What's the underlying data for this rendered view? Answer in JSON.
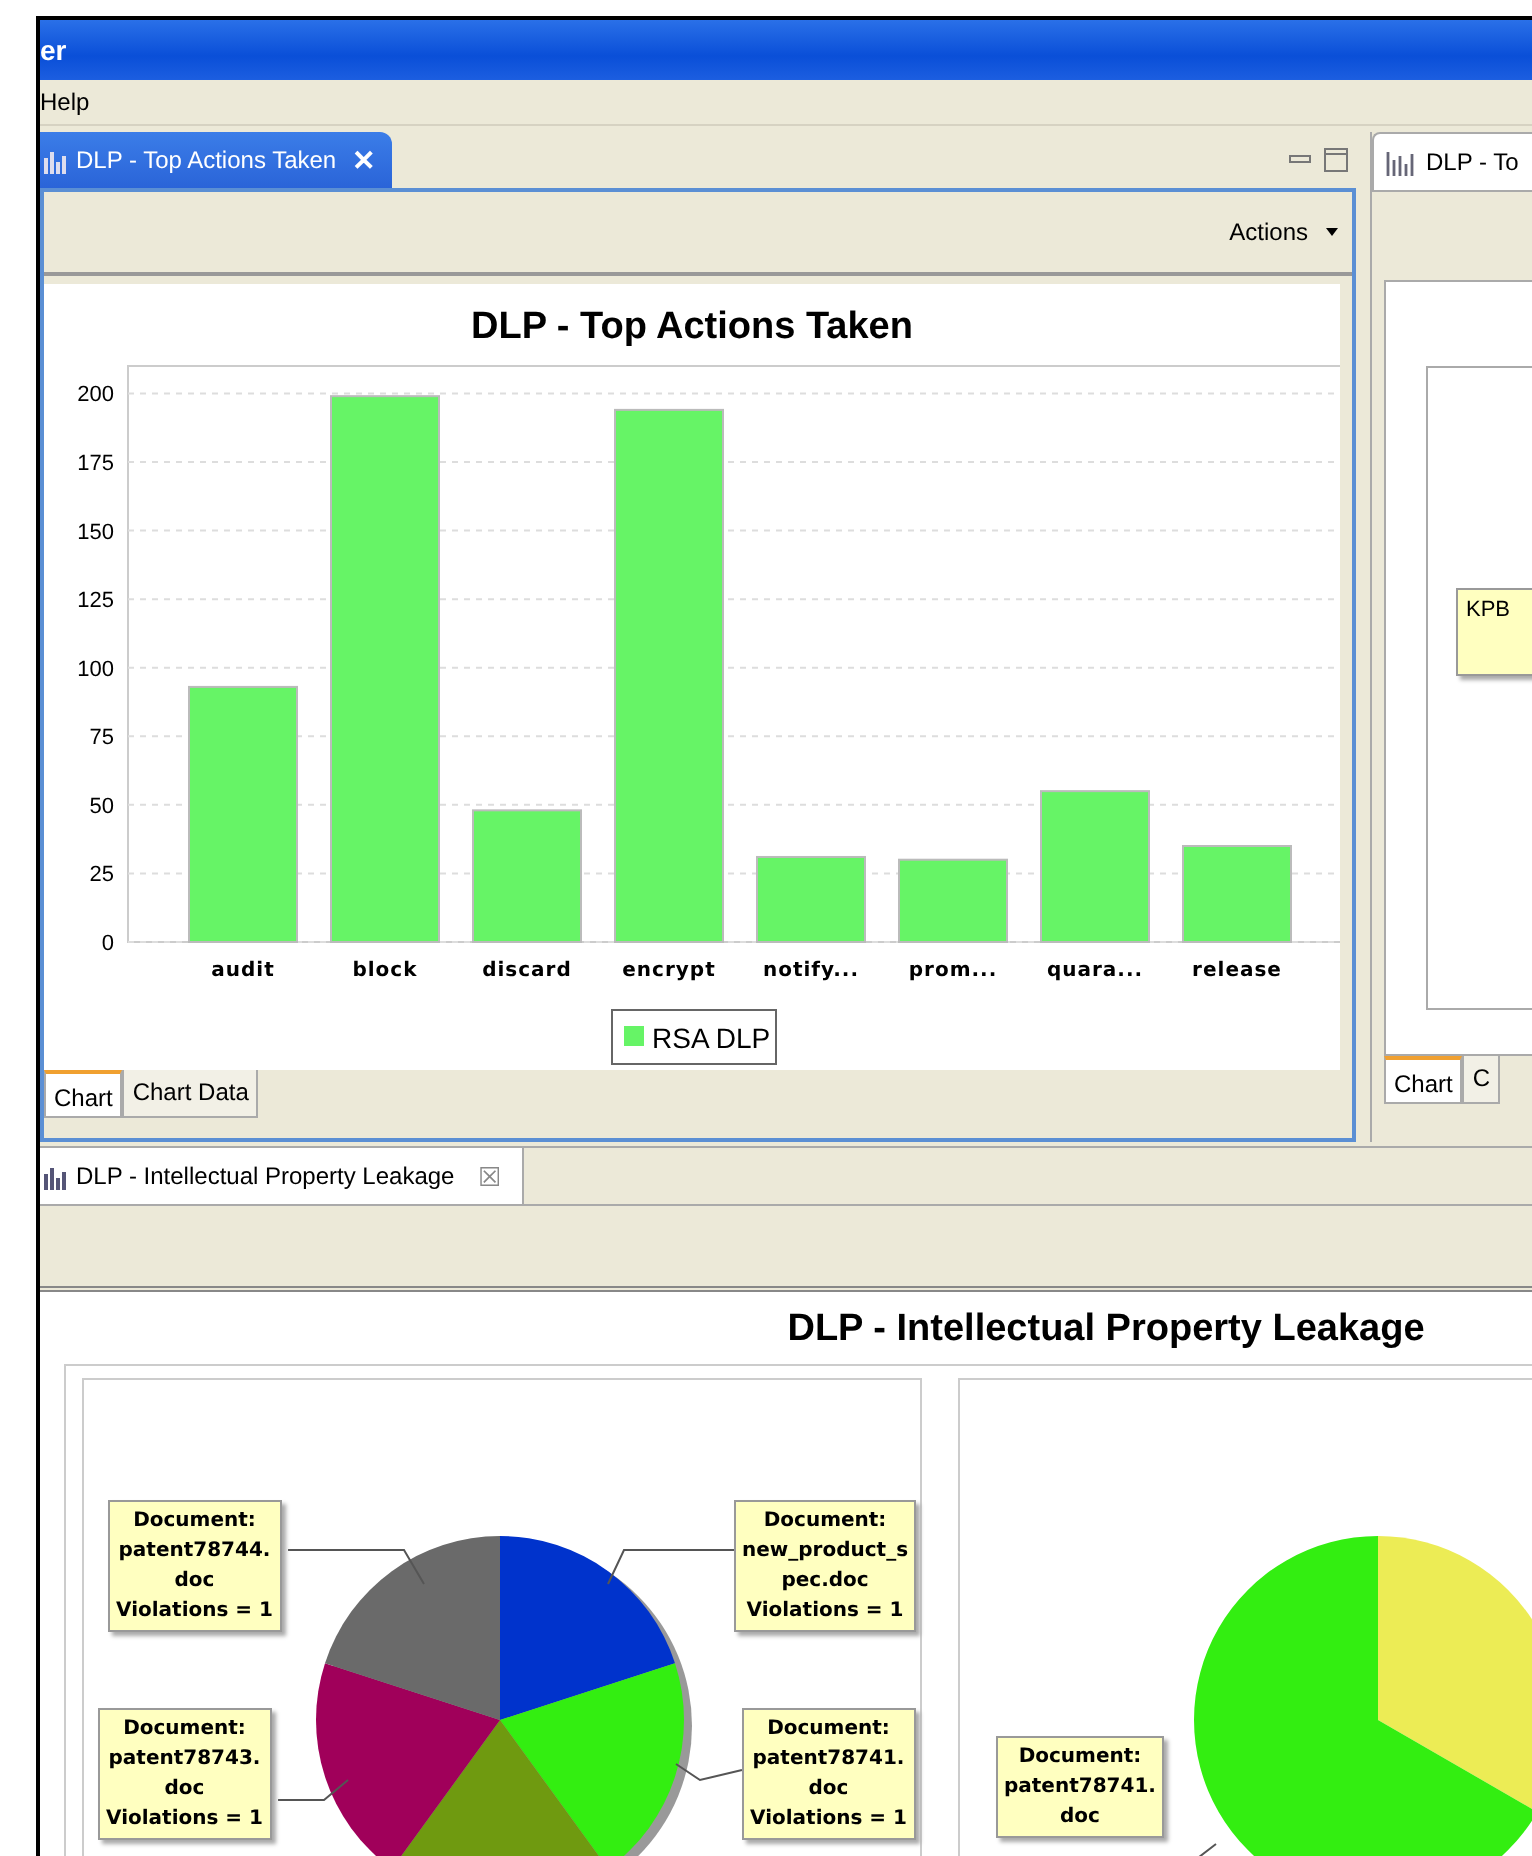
{
  "window": {
    "title": "er"
  },
  "menu": [
    "Help"
  ],
  "top_panel": {
    "tab": {
      "label": "DLP - Top Actions Taken",
      "close": "✕",
      "selected": true
    },
    "toolbar": {
      "actions": "Actions"
    },
    "chart_data": {
      "type": "bar",
      "title": "DLP - Top Actions Taken",
      "categories": [
        "audit",
        "block",
        "discard",
        "encrypt",
        "notify...",
        "prom...",
        "quara...",
        "release"
      ],
      "series": [
        {
          "name": "RSA DLP",
          "color": "#66f466",
          "values": [
            93,
            199,
            48,
            194,
            31,
            30,
            55,
            35
          ]
        }
      ],
      "ylim": [
        0,
        210
      ],
      "grid": true,
      "yticks": [
        0,
        25,
        50,
        75,
        100,
        125,
        150,
        175,
        200
      ]
    },
    "bottom_tabs": [
      {
        "label": "Chart",
        "selected": true
      },
      {
        "label": "Chart Data",
        "selected": false
      }
    ]
  },
  "right_panel": {
    "tab": {
      "label": "DLP - To"
    },
    "callout": "KPB",
    "bottom_tabs": [
      {
        "label": "Chart",
        "selected": true
      },
      {
        "label": "C",
        "selected": false
      }
    ]
  },
  "bottom_panel": {
    "tab": {
      "label": "DLP - Intellectual Property Leakage",
      "close": "☒"
    },
    "title": "DLP - Intellectual Property Leakage",
    "left_pie": {
      "callouts": [
        {
          "text": "Document:\npatent78744.\ndoc\nViolations = 1",
          "color": "#6a6a6a"
        },
        {
          "text": "Document:\nnew_product_s\npec.doc\nViolations = 1",
          "color": "#0033cc"
        },
        {
          "text": "Document:\npatent78743.\ndoc\nViolations = 1",
          "color": "#a0005a"
        },
        {
          "text": "Document:\npatent78741.\ndoc\nViolations = 1",
          "color": "#33ee11"
        }
      ]
    },
    "right_pie": {
      "callouts": [
        {
          "text": "Document:\npatent78741.\ndoc",
          "color": "#33ee11"
        }
      ]
    }
  }
}
